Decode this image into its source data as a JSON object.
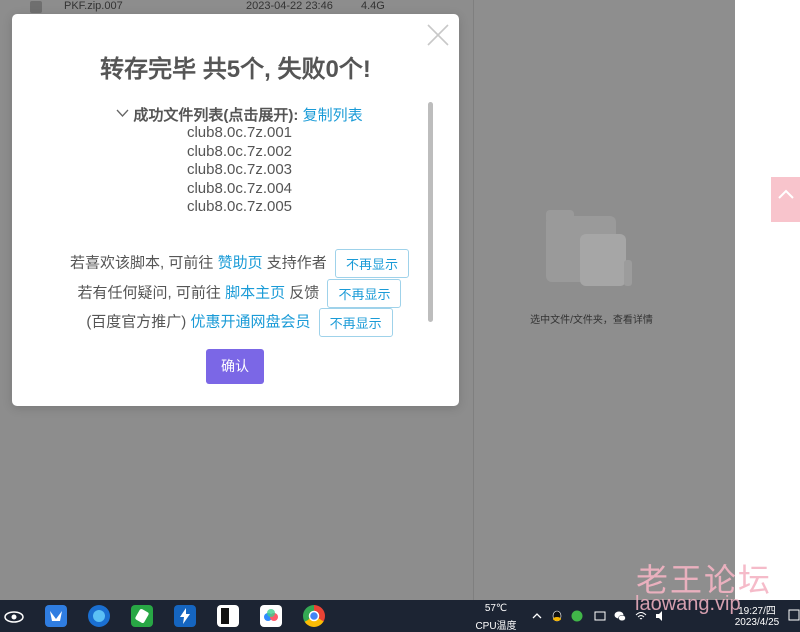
{
  "background": {
    "file_row": {
      "name": "PKF.zip.007",
      "date": "2023-04-22 23:46",
      "size": "4.4G"
    },
    "detail_hint": "选中文件/文件夹，查看详情"
  },
  "modal": {
    "title": "转存完毕 共5个, 失败0个!",
    "list_header": "成功文件列表(点击展开):",
    "copy_link": "复制列表",
    "files": [
      "club8.0c.7z.001",
      "club8.0c.7z.002",
      "club8.0c.7z.003",
      "club8.0c.7z.004",
      "club8.0c.7z.005"
    ],
    "promos": [
      {
        "prefix": "若喜欢该脚本, 可前往",
        "link": "赞助页",
        "suffix": "支持作者",
        "button": "不再显示"
      },
      {
        "prefix": "若有任何疑问, 可前往",
        "link": "脚本主页",
        "suffix": "反馈",
        "button": "不再显示"
      },
      {
        "prefix": "(百度官方推广)",
        "link": "优惠开通网盘会员",
        "suffix": "",
        "button": "不再显示"
      }
    ],
    "confirm_label": "确认"
  },
  "taskbar": {
    "temperature": "57℃",
    "temp_label": "CPU温度",
    "time": "19:27/四",
    "date": "2023/4/25"
  },
  "watermark": {
    "line1": "老王论坛",
    "line2": "laowang.vip"
  },
  "colors": {
    "accent": "#7b67e6",
    "link": "#1a9bd7",
    "taskbar": "#1c2433"
  }
}
